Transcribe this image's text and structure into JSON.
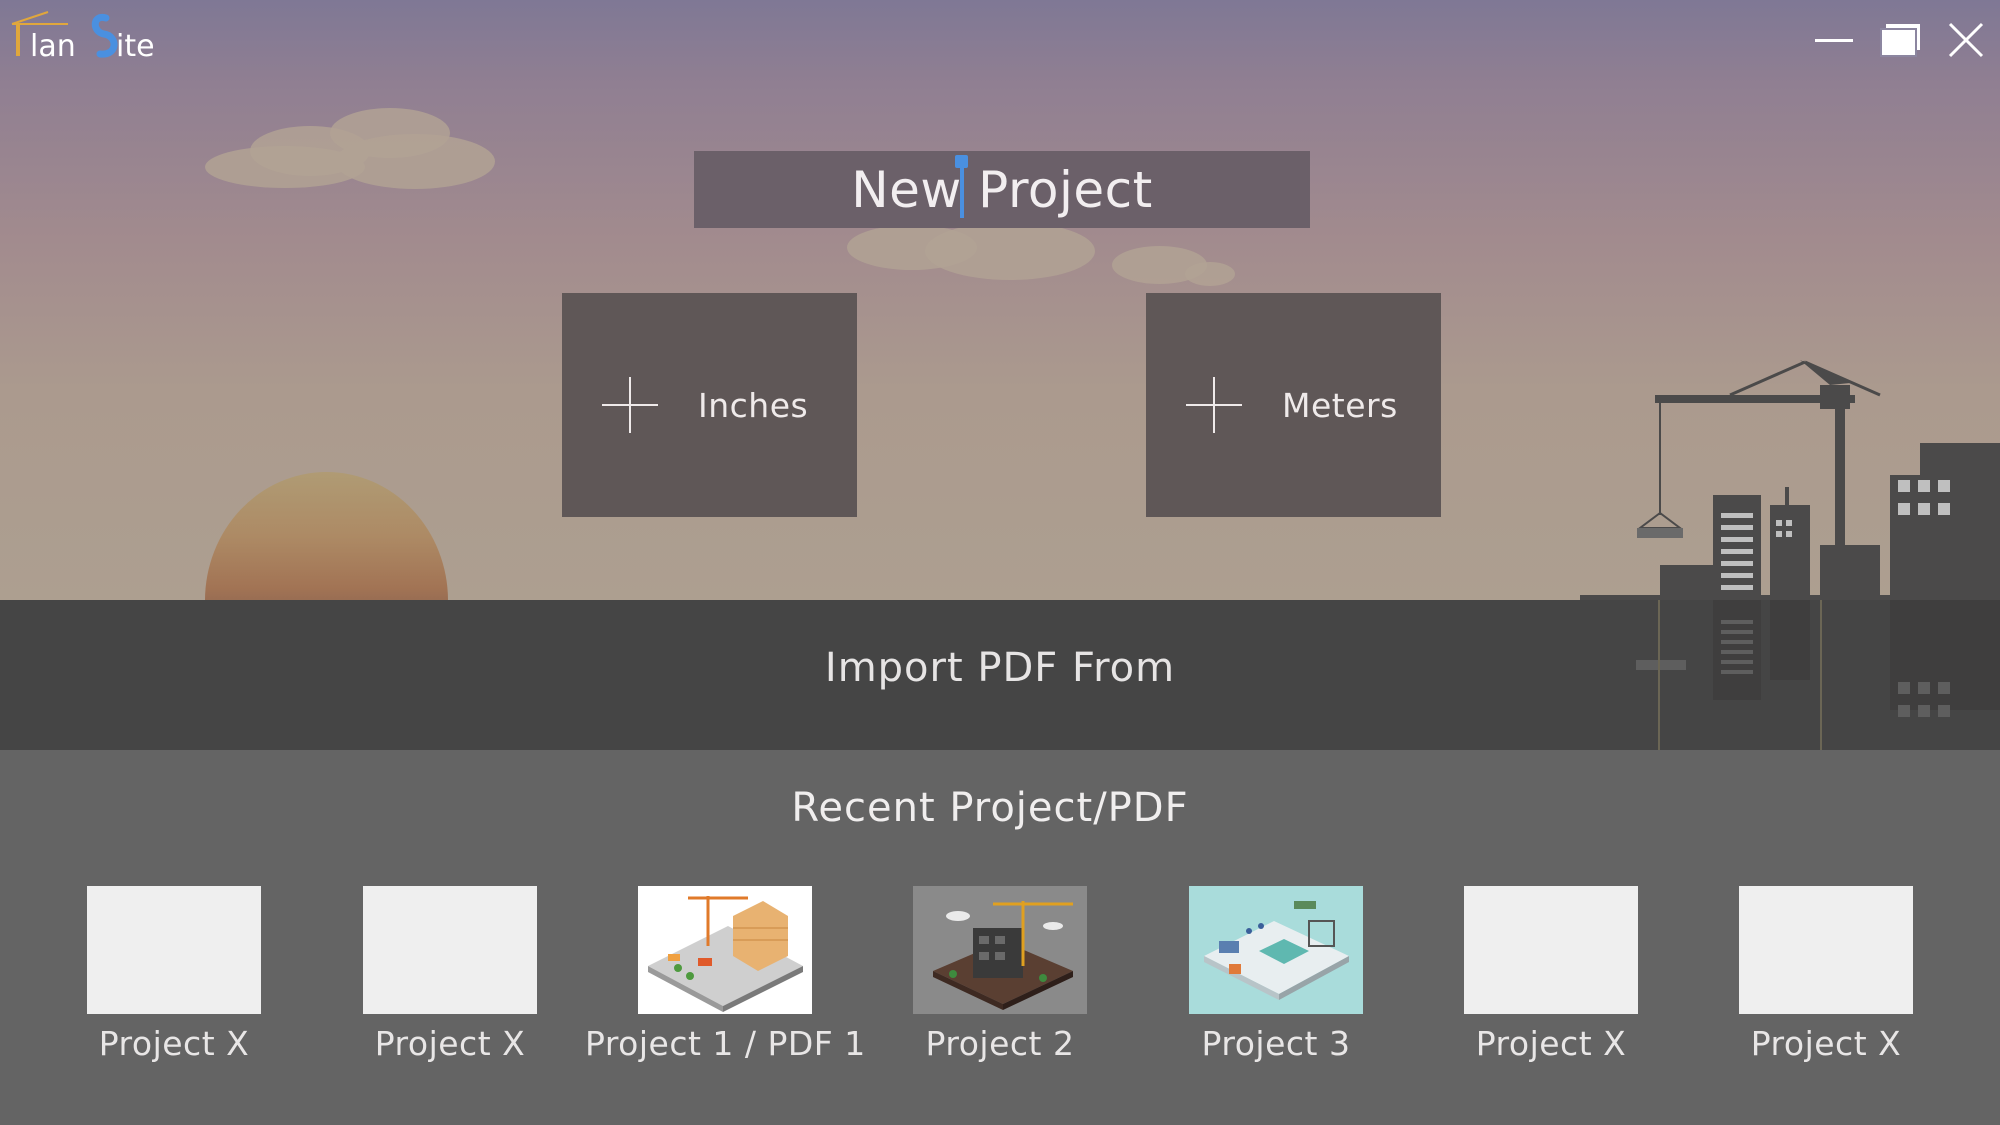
{
  "app": {
    "name": "PlanSite"
  },
  "window": {
    "minimize_icon": "minimize-icon",
    "maximize_icon": "maximize-icon",
    "close_icon": "close-icon"
  },
  "new_project": {
    "value": "New Project"
  },
  "units": [
    {
      "label": "Inches",
      "icon": "plus-icon"
    },
    {
      "label": "Meters",
      "icon": "plus-icon"
    }
  ],
  "import": {
    "label": "Import PDF From"
  },
  "recent": {
    "title": "Recent Project/PDF",
    "items": [
      {
        "label": "Project X",
        "thumb": "blank"
      },
      {
        "label": "Project X",
        "thumb": "blank"
      },
      {
        "label": "Project 1 / PDF 1",
        "thumb": "construction-site-illustration"
      },
      {
        "label": "Project 2",
        "thumb": "building-crane-illustration"
      },
      {
        "label": "Project 3",
        "thumb": "warehouse-illustration"
      },
      {
        "label": "Project X",
        "thumb": "blank"
      },
      {
        "label": "Project X",
        "thumb": "blank"
      }
    ]
  },
  "colors": {
    "accent": "#4a90e0",
    "ground": "#454545",
    "panel": "#646464"
  }
}
